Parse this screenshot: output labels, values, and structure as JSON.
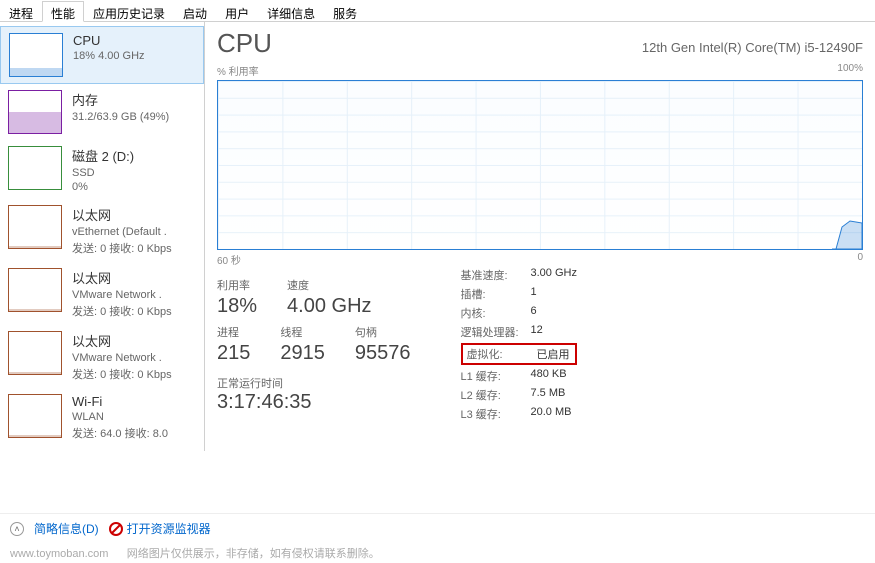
{
  "tabs": [
    "进程",
    "性能",
    "应用历史记录",
    "启动",
    "用户",
    "详细信息",
    "服务"
  ],
  "active_tab": 1,
  "sidebar": {
    "items": [
      {
        "title": "CPU",
        "sub": "18% 4.00 GHz",
        "type": "cpu"
      },
      {
        "title": "内存",
        "sub": "31.2/63.9 GB (49%)",
        "type": "mem"
      },
      {
        "title": "磁盘 2 (D:)",
        "sub": "SSD",
        "sub2": "0%",
        "type": "disk"
      },
      {
        "title": "以太网",
        "sub": "vEthernet (Default .",
        "sub2": "发送: 0 接收: 0 Kbps",
        "type": "eth"
      },
      {
        "title": "以太网",
        "sub": "VMware Network .",
        "sub2": "发送: 0 接收: 0 Kbps",
        "type": "eth"
      },
      {
        "title": "以太网",
        "sub": "VMware Network .",
        "sub2": "发送: 0 接收: 0 Kbps",
        "type": "eth"
      },
      {
        "title": "Wi-Fi",
        "sub": "WLAN",
        "sub2": "发送: 64.0 接收: 8.0",
        "type": "wifi"
      }
    ],
    "active_index": 0
  },
  "content": {
    "title": "CPU",
    "cpu_name": "12th Gen Intel(R) Core(TM) i5-12490F",
    "chart_top_left": "% 利用率",
    "chart_top_right": "100%",
    "chart_bottom_left": "60 秒",
    "chart_bottom_right": "0",
    "stats": [
      {
        "label": "利用率",
        "value": "18%"
      },
      {
        "label": "速度",
        "value": "4.00 GHz"
      }
    ],
    "stats2": [
      {
        "label": "进程",
        "value": "215"
      },
      {
        "label": "线程",
        "value": "2915"
      },
      {
        "label": "句柄",
        "value": "95576"
      }
    ],
    "details": [
      {
        "key": "基准速度:",
        "val": "3.00 GHz"
      },
      {
        "key": "插槽:",
        "val": "1"
      },
      {
        "key": "内核:",
        "val": "6"
      },
      {
        "key": "逻辑处理器:",
        "val": "12"
      },
      {
        "key": "虚拟化:",
        "val": "已启用",
        "highlight": true
      },
      {
        "key": "L1 缓存:",
        "val": "480 KB"
      },
      {
        "key": "L2 缓存:",
        "val": "7.5 MB"
      },
      {
        "key": "L3 缓存:",
        "val": "20.0 MB"
      }
    ],
    "uptime_label": "正常运行时间",
    "uptime_value": "3:17:46:35"
  },
  "bottom": {
    "fewer_details": "简略信息(D)",
    "open_monitor": "打开资源监视器"
  },
  "footer": {
    "site": "www.toymoban.com",
    "note": "网络图片仅供展示，非存储，如有侵权请联系删除。"
  },
  "chart_data": {
    "type": "area",
    "title": "% 利用率",
    "xlabel": "60 秒",
    "ylabel": "",
    "ylim": [
      0,
      100
    ],
    "xlim": [
      60,
      0
    ],
    "series": [
      {
        "name": "CPU 利用率",
        "values_recent_end": [
          0,
          0,
          0,
          0,
          0,
          0,
          0,
          0,
          0,
          0,
          0,
          0,
          0,
          0,
          0,
          0,
          0,
          0,
          0,
          0,
          0,
          0,
          0,
          0,
          0,
          0,
          0,
          0,
          0,
          0,
          0,
          0,
          0,
          0,
          0,
          0,
          0,
          0,
          0,
          0,
          0,
          0,
          0,
          0,
          0,
          0,
          0,
          0,
          0,
          0,
          0,
          0,
          0,
          0,
          0,
          0,
          5,
          15,
          18,
          18
        ]
      }
    ]
  }
}
